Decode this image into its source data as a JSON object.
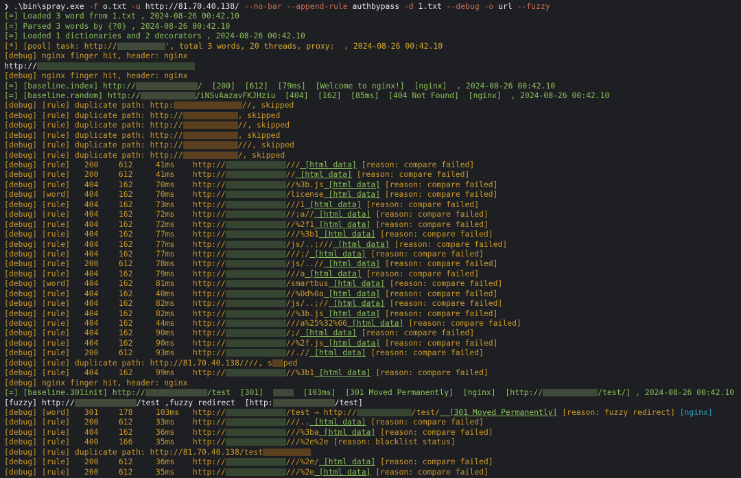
{
  "prompt": {
    "symbol": "❯",
    "command": ".\\bin\\spray.exe",
    "args": [
      {
        "t": "-f",
        "k": "flag"
      },
      {
        "t": " o.txt ",
        "k": "plain"
      },
      {
        "t": "-u",
        "k": "flag"
      },
      {
        "t": " http://81.70.40.138/ ",
        "k": "plain"
      },
      {
        "t": "--no-bar --append-rule",
        "k": "flag"
      },
      {
        "t": " authbypass ",
        "k": "plain"
      },
      {
        "t": "-d",
        "k": "flag"
      },
      {
        "t": " 1.txt ",
        "k": "plain"
      },
      {
        "t": "--debug -o",
        "k": "flag"
      },
      {
        "t": " url ",
        "k": "plain"
      },
      {
        "t": "--fuzzy",
        "k": "flag"
      }
    ]
  },
  "info_lines": [
    "[=] Loaded 3 word from 1.txt , 2024-08-26 00:42.10",
    "[=] Parsed 3 words by {?0} , 2024-08-26 00:42.10",
    "[=] Loaded 1 dictionaries and 2 decorators , 2024-08-26 00:42.10",
    "[*] [pool] task: http://",
    "', total 3 words, 20 threads, proxy:  , 2024-08-26 00:42.10",
    "[debug] nginx finger hit, header: nginx",
    "http://",
    "[debug] nginx finger hit, header: nginx",
    "[=] [baseline.index] http://",
    "/  [200]  [612]  [79ms]  [Welcome to nginx!]  [nginx]  , 2024-08-26 00:42.10",
    "[=] [baseline.random] http://",
    "/iNSvAazavFKJHziu  [404]  [162]  [85ms]  [404 Not Found]  [nginx]  , 2024-08-26 00:42.10"
  ],
  "dup_lines": [
    {
      "prefix": "[debug] [rule] duplicate path: http:",
      "suffix": "//, skipped"
    },
    {
      "prefix": "[debug] [rule] duplicate path: http://",
      "suffix": ", skipped"
    },
    {
      "prefix": "[debug] [rule] duplicate path: http://",
      "suffix": "//, skipped"
    },
    {
      "prefix": "[debug] [rule] duplicate path: http://",
      "suffix": ", skipped"
    },
    {
      "prefix": "[debug] [rule] duplicate path: http://",
      "suffix": "///, skipped"
    },
    {
      "prefix": "[debug] [rule] duplicate path: http://",
      "suffix": "/, skipped"
    }
  ],
  "rows1": [
    {
      "tag": "[rule]",
      "code": "200",
      "size": "612",
      "time": "41ms",
      "path": "///",
      "data": " [html data]",
      "reason": "[reason: compare failed]"
    },
    {
      "tag": "[rule]",
      "code": "200",
      "size": "612",
      "time": "41ms",
      "path": "//",
      "data": " [html data]",
      "reason": "[reason: compare failed]"
    },
    {
      "tag": "[rule]",
      "code": "404",
      "size": "162",
      "time": "70ms",
      "path": "//%3b.js",
      "data": " [html data]",
      "reason": "[reason: compare failed]"
    },
    {
      "tag": "[word]",
      "code": "404",
      "size": "162",
      "time": "70ms",
      "path": "/license",
      "data": " [html data]",
      "reason": "[reason: compare failed]"
    },
    {
      "tag": "[rule]",
      "code": "404",
      "size": "162",
      "time": "73ms",
      "path": "///1",
      "data": " [html data]",
      "reason": "[reason: compare failed]"
    },
    {
      "tag": "[rule]",
      "code": "404",
      "size": "162",
      "time": "72ms",
      "path": "//;a//",
      "data": " [html data]",
      "reason": "[reason: compare failed]"
    },
    {
      "tag": "[rule]",
      "code": "404",
      "size": "162",
      "time": "72ms",
      "path": "//%2f1",
      "data": " [html data]",
      "reason": "[reason: compare failed]"
    },
    {
      "tag": "[rule]",
      "code": "404",
      "size": "162",
      "time": "77ms",
      "path": "///%3b1",
      "data": " [html data]",
      "reason": "[reason: compare failed]"
    },
    {
      "tag": "[rule]",
      "code": "404",
      "size": "162",
      "time": "77ms",
      "path": "/js/..;///",
      "data": " [html data]",
      "reason": "[reason: compare failed]"
    },
    {
      "tag": "[rule]",
      "code": "404",
      "size": "162",
      "time": "77ms",
      "path": "///;/",
      "data": " [html data]",
      "reason": "[reason: compare failed]"
    },
    {
      "tag": "[rule]",
      "code": "200",
      "size": "612",
      "time": "78ms",
      "path": "/js/..//",
      "data": " [html data]",
      "reason": "[reason: compare failed]"
    },
    {
      "tag": "[rule]",
      "code": "404",
      "size": "162",
      "time": "79ms",
      "path": "///a",
      "data": " [html data]",
      "reason": "[reason: compare failed]"
    },
    {
      "tag": "[word]",
      "code": "404",
      "size": "162",
      "time": "81ms",
      "path": "/smartbus",
      "data": " [html data]",
      "reason": "[reason: compare failed]"
    },
    {
      "tag": "[rule]",
      "code": "404",
      "size": "162",
      "time": "40ms",
      "path": "//%0d%0a",
      "data": " [html data]",
      "reason": "[reason: compare failed]"
    },
    {
      "tag": "[rule]",
      "code": "404",
      "size": "162",
      "time": "82ms",
      "path": "/js/..;//",
      "data": " [html data]",
      "reason": "[reason: compare failed]"
    },
    {
      "tag": "[rule]",
      "code": "404",
      "size": "162",
      "time": "82ms",
      "path": "//%3b.js",
      "data": " [html data]",
      "reason": "[reason: compare failed]"
    },
    {
      "tag": "[rule]",
      "code": "404",
      "size": "162",
      "time": "44ms",
      "path": "///a%25%32%66",
      "data": " [html data]",
      "reason": "[reason: compare failed]"
    },
    {
      "tag": "[rule]",
      "code": "404",
      "size": "162",
      "time": "90ms",
      "path": "/;/",
      "data": " [html data]",
      "reason": "[reason: compare failed]"
    },
    {
      "tag": "[rule]",
      "code": "404",
      "size": "162",
      "time": "90ms",
      "path": "//%2f.js",
      "data": " [html data]",
      "reason": "[reason: compare failed]"
    },
    {
      "tag": "[rule]",
      "code": "200",
      "size": "612",
      "time": "93ms",
      "path": "//.//",
      "data": " [html data]",
      "reason": "[reason: compare failed]"
    }
  ],
  "mid": {
    "dup": "[debug] [rule] duplicate path: http://81.70.40.138////, s",
    "dup_tail": "ped",
    "row": {
      "tag": "[rule]",
      "code": "404",
      "size": "162",
      "time": "99ms",
      "path": "//%3b1",
      "data": " [html data]",
      "reason": "[reason: compare failed]"
    },
    "finger": "[debug] nginx finger hit, header: nginx",
    "init_a": "[=] [baseline.301init] http://",
    "init_b": "/test  [301]  ",
    "init_c": "  [103ms]  [301 Moved Permanently]  [nginx]  [http://",
    "init_d": "/test/] , 2024-08-26 00:42.10",
    "fuzzy_a": "[fuzzy] http://",
    "fuzzy_b": "/test ,fuzzy redirect  [http:",
    "fuzzy_c": "/test]"
  },
  "rows2": [
    {
      "tag": "[word]",
      "code": "301",
      "size": "178",
      "time": "103ms",
      "path": "/test → http://",
      "extra": "/test/",
      "data": "  [301 Moved Permanently]",
      "reason": "[reason: fuzzy redirect]",
      "server": "[nginx]"
    },
    {
      "tag": "[rule]",
      "code": "200",
      "size": "612",
      "time": "33ms",
      "path": "///..",
      "data": " [html data]",
      "reason": "[reason: compare failed]"
    },
    {
      "tag": "[rule]",
      "code": "404",
      "size": "162",
      "time": "36ms",
      "path": "///%3ba",
      "data": " [html data]",
      "reason": "[reason: compare failed]"
    },
    {
      "tag": "[rule]",
      "code": "400",
      "size": "166",
      "time": "35ms",
      "path": "///%2e%2e",
      "data": "",
      "reason": "[reason: blacklist status]"
    }
  ],
  "dup2": {
    "prefix": "[debug] [rule] duplicate path: http://81.70.40.138/test"
  },
  "rows3": [
    {
      "tag": "[rule]",
      "code": "200",
      "size": "612",
      "time": "36ms",
      "path": "///%2e/",
      "data": " [html data]",
      "reason": "[reason: compare failed]"
    },
    {
      "tag": "[rule]",
      "code": "200",
      "size": "612",
      "time": "35ms",
      "path": "///%2e",
      "data": " [html data]",
      "reason": "[reason: compare failed]"
    }
  ],
  "labels": {
    "debug": "[debug]",
    "url_prefix": "http://"
  }
}
